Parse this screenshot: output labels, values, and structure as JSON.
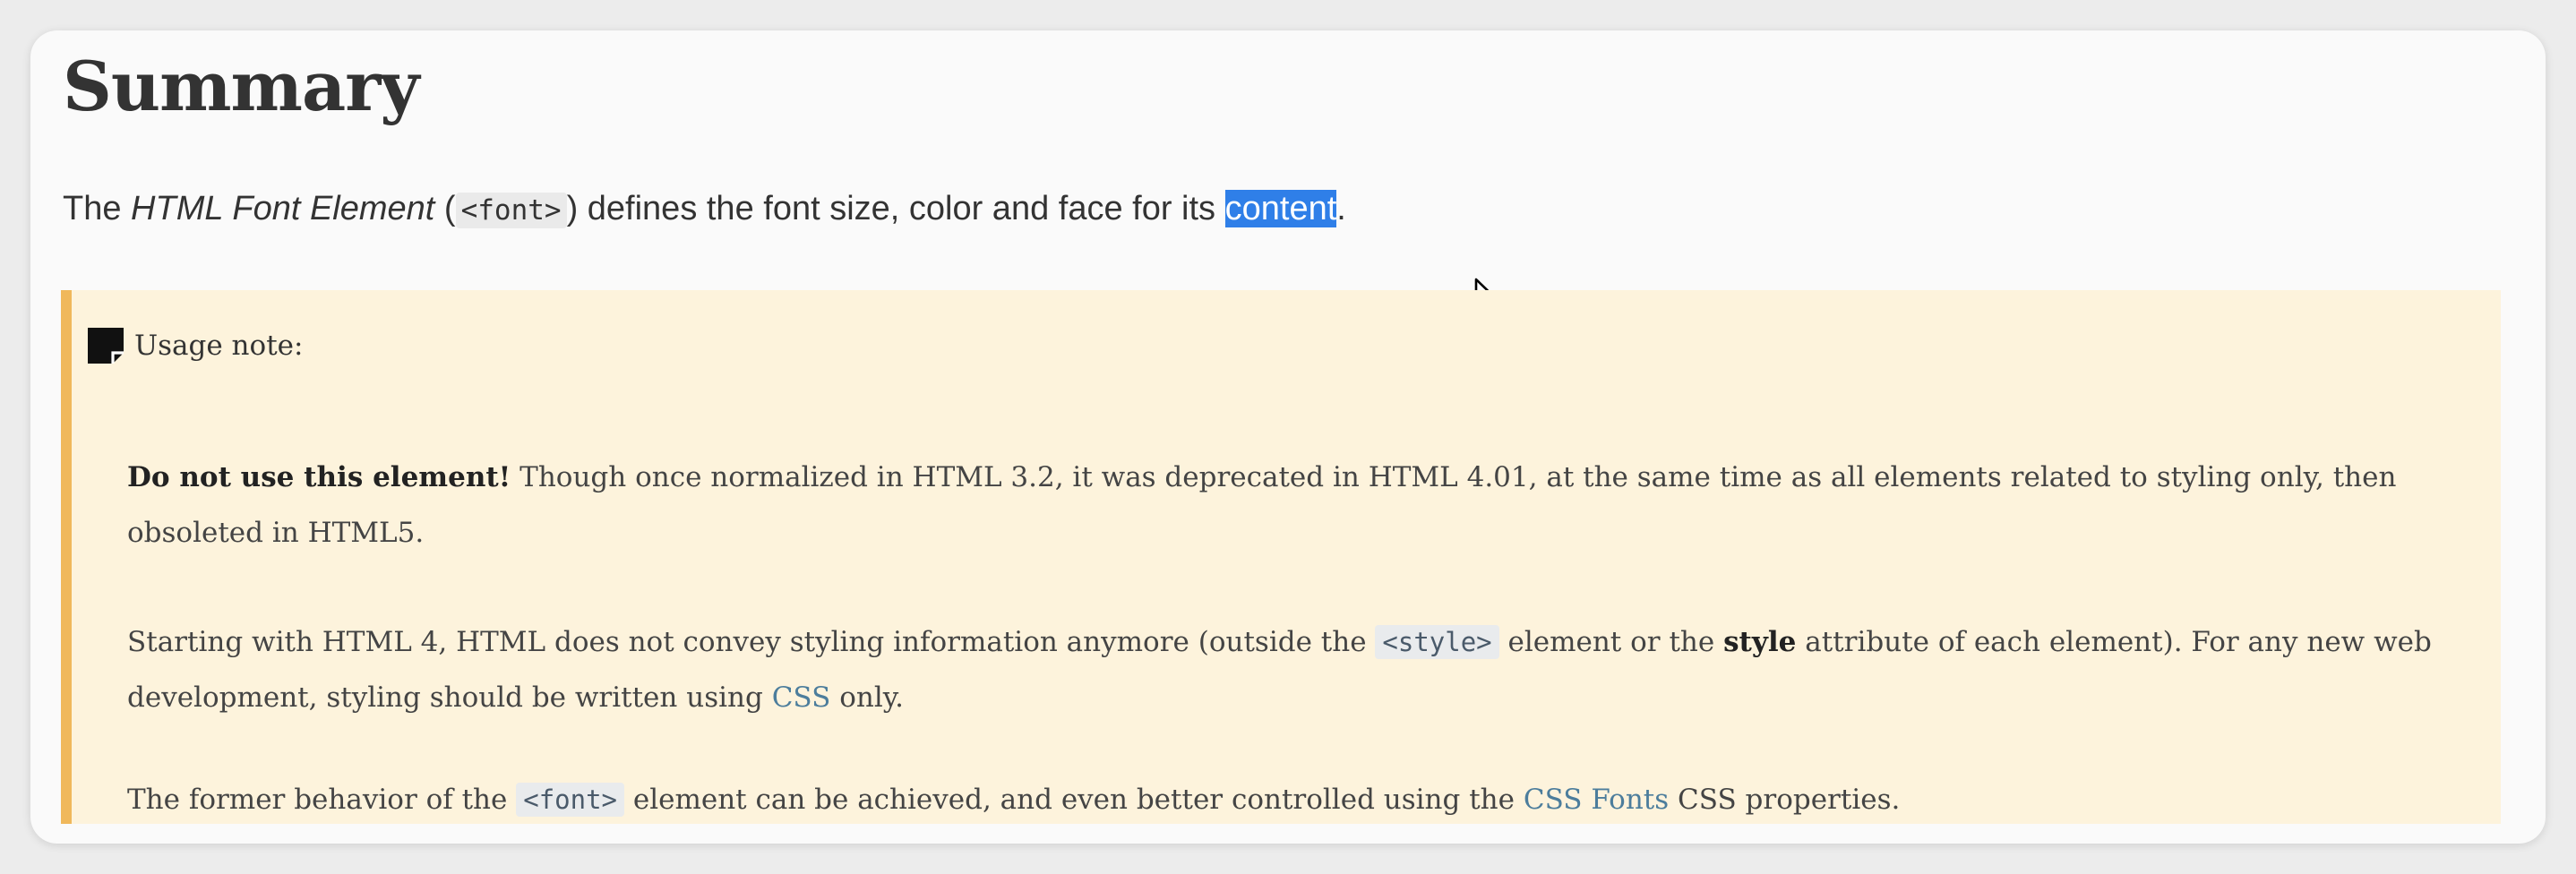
{
  "heading": "Summary",
  "summary": {
    "text_before": "The",
    "em_text": "HTML Font Element",
    "open_paren": "(",
    "code": "<font>",
    "close_paren": ")",
    "text_middle": "defines the font size, color and face for its",
    "selected_word": "content",
    "period": "."
  },
  "note": {
    "icon": "note-icon",
    "label": "Usage note:",
    "p1": {
      "strong": "Do not use this element!",
      "text": "Though once normalized in HTML 3.2, it was deprecated in HTML 4.01, at the same time as all elements related to styling only, then obsoleted in HTML5."
    },
    "p2": {
      "before": "Starting with HTML 4, HTML does not convey styling information anymore (outside the",
      "code": "<style>",
      "middle": "element or the",
      "strong": "style",
      "after": "attribute of each element). For any new web development, styling should be written using",
      "link": "CSS",
      "end": "only."
    },
    "p3": {
      "before": "The former behavior of the",
      "code": "<font>",
      "middle": "element can be achieved, and even better controlled using the",
      "link": "CSS Fonts",
      "end": "CSS properties."
    }
  },
  "cursor_icon": "mouse-pointer-icon",
  "colors": {
    "note_background": "#fdf3dc",
    "note_border": "#f0b85b",
    "selection": "#2f7fe8",
    "link": "#4c7d9c"
  }
}
